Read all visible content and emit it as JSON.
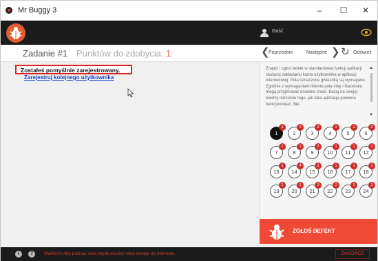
{
  "window": {
    "title": "Mr Buggy 3",
    "min_label": "–",
    "max_label": "☐",
    "close_label": "✕"
  },
  "header": {
    "user_label": "Gość"
  },
  "task": {
    "title": "Zadanie #1",
    "points_label": "Punktów do zdobycia:",
    "points_value": "1"
  },
  "nav": {
    "prev": "Poprzednie",
    "next": "Następne",
    "refresh": "Odśwież"
  },
  "content": {
    "success": "Zostałeś pomyślnie zarejestrowany.",
    "register_link": "Zarejestruj kolejnego użytkownika"
  },
  "description": "Znajdź i zgłoś defekt w standardowej funkcji aplikacji służącej zakładaniu konta użytkownika w aplikacji internetowej. Pola oznaczone gwiazdką są wymagane. Zgodnie z wymaganiami klienta pola Imię i Nazwisko mogą przyjmować dowolne znaki. Bazuj na swojej wiedzy odnośnie tego, jak taka aplikacja powinna funkcjonować. Nie",
  "tasks": [
    {
      "n": "1",
      "badge": "1",
      "active": true
    },
    {
      "n": "2",
      "badge": "2"
    },
    {
      "n": "3",
      "badge": "2"
    },
    {
      "n": "4",
      "badge": "1"
    },
    {
      "n": "5",
      "badge": "1"
    },
    {
      "n": "6",
      "badge": "2"
    },
    {
      "n": "7",
      "badge": "1"
    },
    {
      "n": "8",
      "badge": "1"
    },
    {
      "n": "9",
      "badge": "2"
    },
    {
      "n": "10",
      "badge": "1"
    },
    {
      "n": "11",
      "badge": "1"
    },
    {
      "n": "12",
      "badge": "1"
    },
    {
      "n": "13",
      "badge": "1"
    },
    {
      "n": "14",
      "badge": "4"
    },
    {
      "n": "15",
      "badge": "1"
    },
    {
      "n": "16",
      "badge": "1"
    },
    {
      "n": "17",
      "badge": "1"
    },
    {
      "n": "18",
      "badge": "1"
    },
    {
      "n": "19",
      "badge": "1"
    },
    {
      "n": "20",
      "badge": "1"
    },
    {
      "n": "21",
      "badge": "2"
    },
    {
      "n": "22",
      "badge": "2"
    },
    {
      "n": "23",
      "badge": "1"
    },
    {
      "n": "24",
      "badge": "1"
    }
  ],
  "report": {
    "label": "ZGŁOŚ DEFEKT"
  },
  "footer": {
    "info_icon": "i",
    "help_icon": "?",
    "warning": "UWAGA! Aby poznać swój wynik musisz mieć dostęp do internetu.",
    "exit_label": "ZAKOŃCZ"
  },
  "colors": {
    "accent": "#e45b2f",
    "report": "#ef4a36",
    "dark": "#1b1b1b",
    "badge": "#cf2a2a"
  }
}
